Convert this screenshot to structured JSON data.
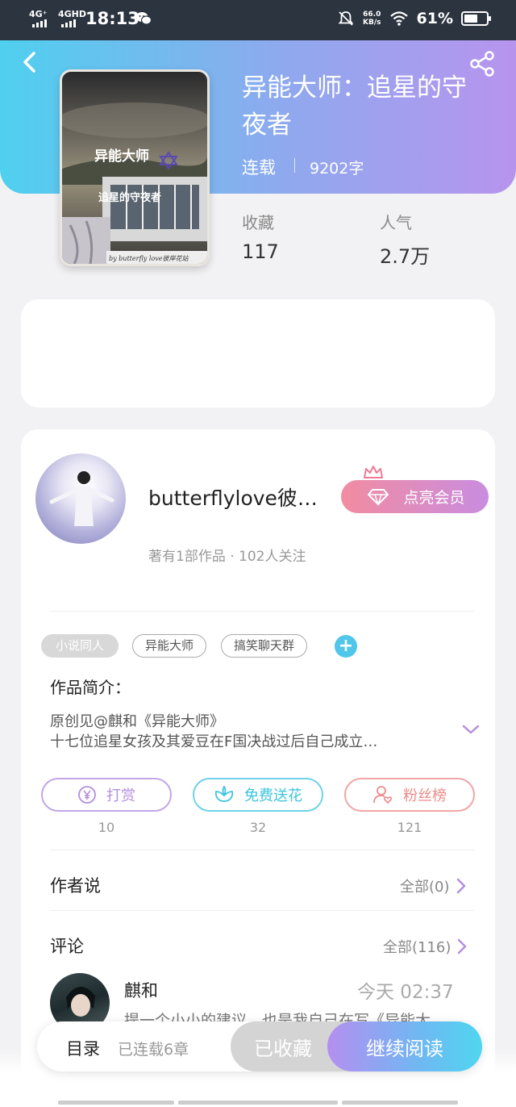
{
  "status_bar": {
    "network1": "4G⁺",
    "network2": "4GHD",
    "time": "18:13",
    "speed_value": "66.0",
    "speed_unit": "KB/s",
    "battery": "61%",
    "battery_level": 0.61
  },
  "book": {
    "title": "异能大师：追星的守夜者",
    "status": "连载",
    "word_count": "9202字",
    "stats": [
      {
        "label": "收藏",
        "value": "117"
      },
      {
        "label": "人气",
        "value": "2.7万"
      }
    ],
    "cover_text_line1": "异能大师",
    "cover_text_line2": "追星的守夜者",
    "cover_credit": "by butterfly love彼岸花站"
  },
  "author": {
    "name": "butterflylove彼…",
    "meta": "著有1部作品 · 102人关注",
    "vip_button": "点亮会员"
  },
  "tags": [
    "小说同人",
    "异能大师",
    "搞笑聊天群"
  ],
  "tag_add": "+",
  "intro": {
    "title": "作品简介：",
    "line1": "原创见@麒和《异能大师》",
    "line2": "十七位追星女孩及其爱豆在F国决战过后自己成立…"
  },
  "actions": [
    {
      "label": "打赏",
      "count": "10",
      "color": "#b48fe0",
      "icon": "yen-coin-icon"
    },
    {
      "label": "免费送花",
      "count": "32",
      "color": "#3cc4de",
      "icon": "flower-icon"
    },
    {
      "label": "粉丝榜",
      "count": "121",
      "color": "#ee8a8a",
      "icon": "fan-person-icon"
    }
  ],
  "author_says": {
    "title": "作者说",
    "link": "全部(0)"
  },
  "comments": {
    "title": "评论",
    "link": "全部(116)",
    "first": {
      "name": "麒和",
      "time": "今天 02:37",
      "text": "提一个小小的建议，也是我自己在写《异能大"
    }
  },
  "bottom_bar": {
    "toc_label": "目录",
    "toc_count": "已连载6章",
    "fav_button": "已收藏",
    "read_button": "继续阅读"
  }
}
